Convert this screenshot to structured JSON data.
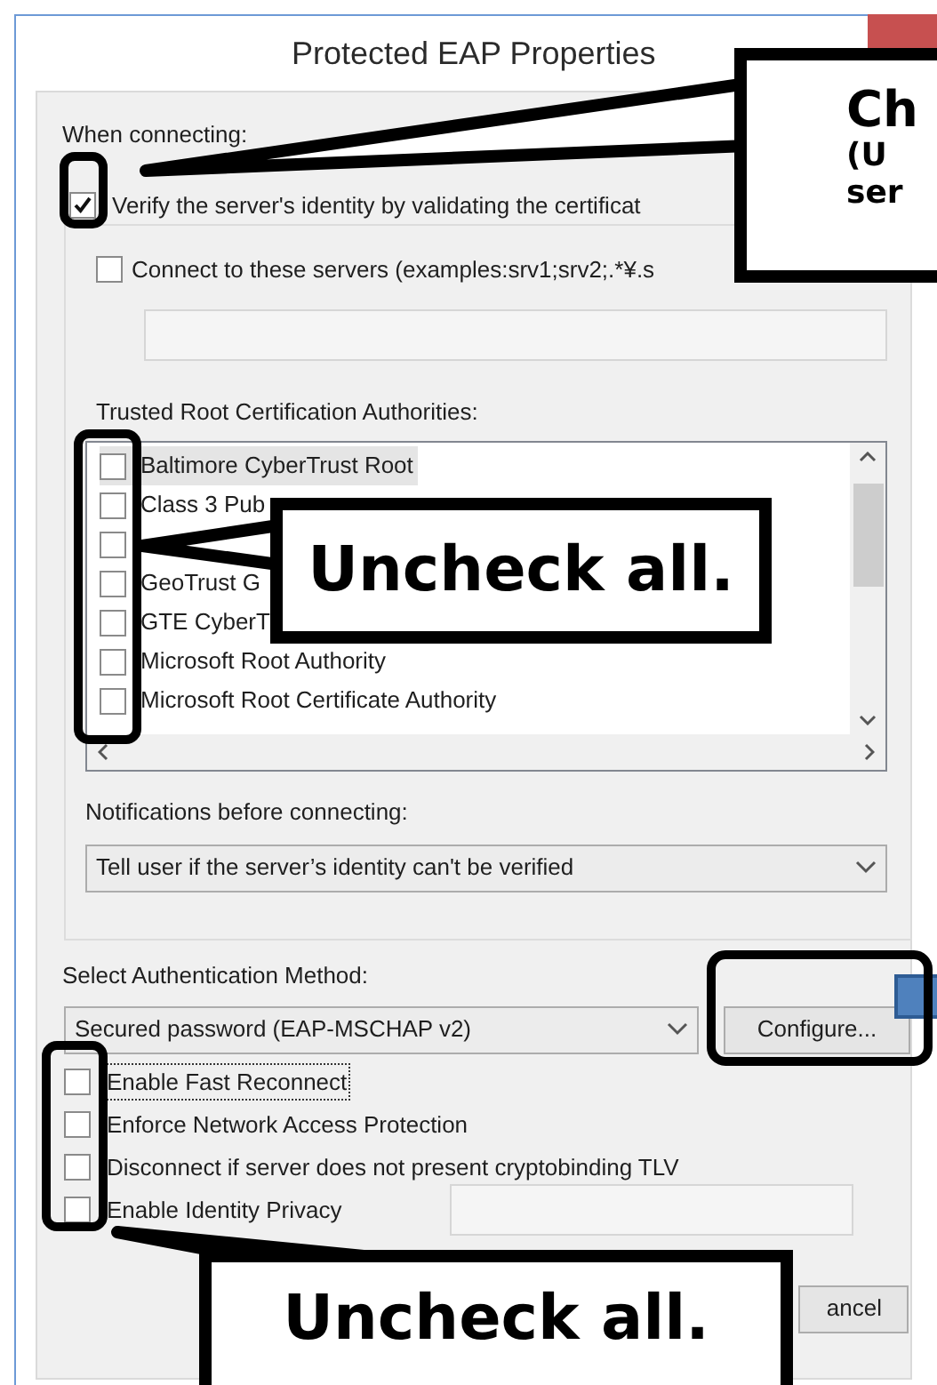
{
  "window": {
    "title": "Protected EAP Properties"
  },
  "when_connecting": {
    "label": "When connecting:",
    "verify": {
      "label": "Verify the server's identity by validating the certificat",
      "checked": true
    },
    "connect_servers": {
      "label": "Connect to these servers (examples:srv1;srv2;.*¥.s",
      "checked": false
    }
  },
  "trusted_root": {
    "label": "Trusted Root Certification Authorities:",
    "items": [
      {
        "label": "Baltimore CyberTrust Root",
        "checked": false,
        "selected": true
      },
      {
        "label": "Class 3 Pub",
        "checked": false,
        "selected": false
      },
      {
        "checked": false,
        "selected": false
      },
      {
        "label": "GeoTrust G",
        "checked": false,
        "selected": false
      },
      {
        "label": "GTE CyberT",
        "checked": false,
        "selected": false
      },
      {
        "label": "Microsoft Root Authority",
        "checked": false,
        "selected": false
      },
      {
        "label": "Microsoft Root Certificate Authority",
        "checked": false,
        "selected": false
      }
    ]
  },
  "notifications": {
    "label": "Notifications before connecting:",
    "value": "Tell user if the server’s identity can't be verified"
  },
  "auth_method": {
    "label": "Select Authentication Method:",
    "value": "Secured password (EAP-MSCHAP v2)",
    "configure": "Configure..."
  },
  "options": [
    {
      "label": "Enable Fast Reconnect",
      "checked": false,
      "focused": true
    },
    {
      "label": "Enforce Network Access Protection",
      "checked": false,
      "focused": false
    },
    {
      "label": "Disconnect if server does not present cryptobinding TLV",
      "checked": false,
      "focused": false
    },
    {
      "label": "Enable Identity Privacy",
      "checked": false,
      "focused": false
    }
  ],
  "buttons": {
    "cancel": "ancel"
  },
  "annotations": [
    {
      "kind": "callout",
      "lines": [
        "Ch",
        "(U",
        "ser"
      ]
    },
    {
      "kind": "callout",
      "lines": [
        "Uncheck all."
      ]
    },
    {
      "kind": "callout",
      "lines": [
        "Uncheck all."
      ]
    }
  ]
}
